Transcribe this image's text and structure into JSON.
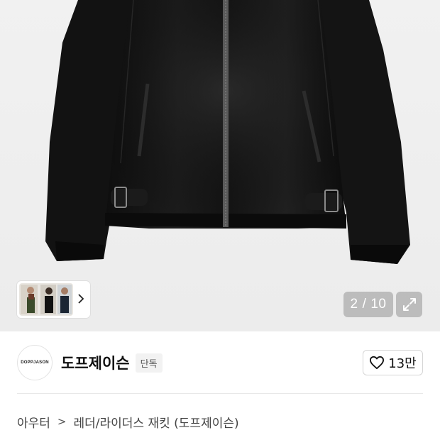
{
  "product_image": {
    "page_current": "2",
    "page_separator": "/",
    "page_total": "10",
    "expand_icon": "expand-arrows-icon",
    "thumbnail_next_icon": "chevron-right-icon"
  },
  "brand": {
    "logo_text": "DOPPJASON",
    "name": "도프제이슨",
    "badge": "단독",
    "like_icon": "heart-outline-icon",
    "like_count": "13만"
  },
  "breadcrumb": {
    "category": "아우터",
    "separator": ">",
    "subcategory": "레더/라이더스 재킷 (도프제이슨)"
  },
  "colors": {
    "image_background": "#eeeeee",
    "overlay_button": "#969696",
    "badge_background": "#f2f2f2",
    "text_primary": "#111111",
    "divider": "#e8e8e8"
  }
}
